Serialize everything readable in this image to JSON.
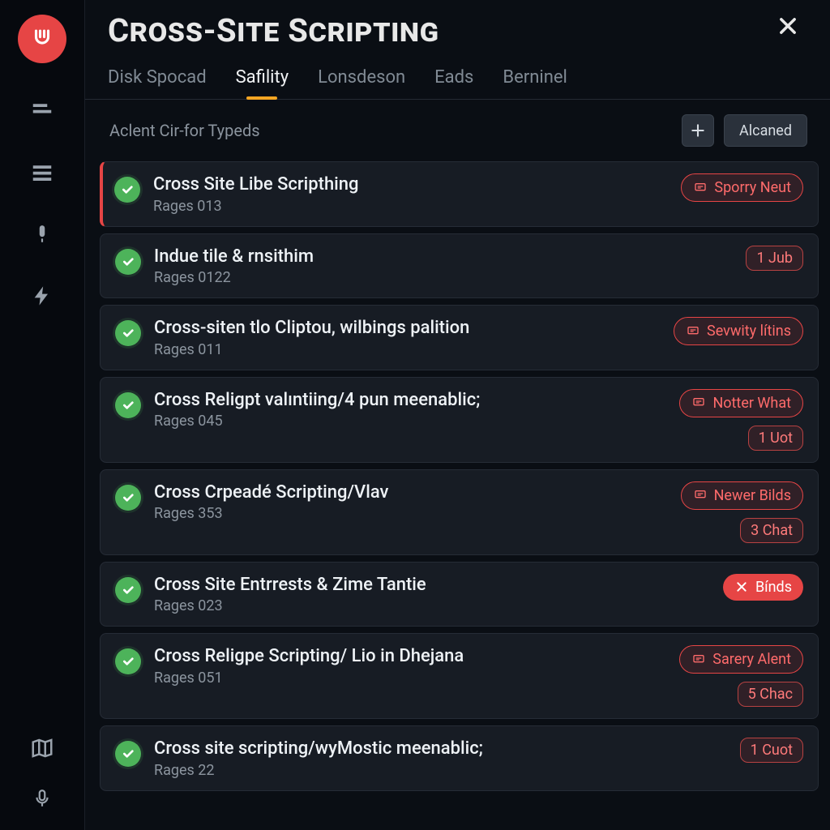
{
  "header": {
    "title": "Cross-Site Scripting"
  },
  "tabs": [
    {
      "label": "Disk Spocad",
      "active": false
    },
    {
      "label": "Safility",
      "active": true
    },
    {
      "label": "Lonsdeson",
      "active": false
    },
    {
      "label": "Eads",
      "active": false
    },
    {
      "label": "Berninel",
      "active": false
    }
  ],
  "subbar": {
    "label": "Aclent Cir-for Typeds",
    "filter_label": "Alcaned"
  },
  "items": [
    {
      "title": "Cross Site Libe Scripthing",
      "sub": "Rages 013",
      "selected": true,
      "pills": [
        {
          "kind": "pill-red-outline",
          "icon": "comment",
          "text": "Sporry Neut"
        }
      ]
    },
    {
      "title": "Indue tile & rnsithim",
      "sub": "Rages 0122",
      "pills": [
        {
          "kind": "chip",
          "text": "1 Jub"
        }
      ]
    },
    {
      "title": "Cross-siten tlo Cliptou, wilbings palition",
      "sub": "Rages 011",
      "pills": [
        {
          "kind": "pill-red-outline",
          "icon": "comment",
          "text": "Sevwity lítins"
        }
      ]
    },
    {
      "title": "Cross Religpt valıntiing/4 pun meenablic;",
      "sub": "Rages 045",
      "pills": [
        {
          "kind": "pill-red-outline",
          "icon": "comment",
          "text": "Notter What"
        },
        {
          "kind": "chip",
          "text": "1 Uot"
        }
      ]
    },
    {
      "title": "Cross Crpeadé Scripting/Vlav",
      "sub": "Rages 353",
      "pills": [
        {
          "kind": "pill-red-outline",
          "icon": "comment",
          "text": "Newer Bilds"
        },
        {
          "kind": "chip",
          "text": "3 Chat"
        }
      ]
    },
    {
      "title": "Cross Site Entrrests & Zime Tantie",
      "sub": "Rages 023",
      "pills": [
        {
          "kind": "pill-red-solid",
          "icon": "x",
          "text": "Bínds"
        }
      ]
    },
    {
      "title": "Cross Religpe Scripting/ Lio in Dhejana",
      "sub": "Rages 051",
      "pills": [
        {
          "kind": "pill-red-outline",
          "icon": "comment",
          "text": "Sarery Alent"
        },
        {
          "kind": "chip",
          "text": "5 Chac"
        }
      ]
    },
    {
      "title": "Cross site scripting/wyMostic meenablic;",
      "sub": "Rages 22",
      "pills": [
        {
          "kind": "chip",
          "text": "1 Cuot"
        }
      ]
    }
  ]
}
